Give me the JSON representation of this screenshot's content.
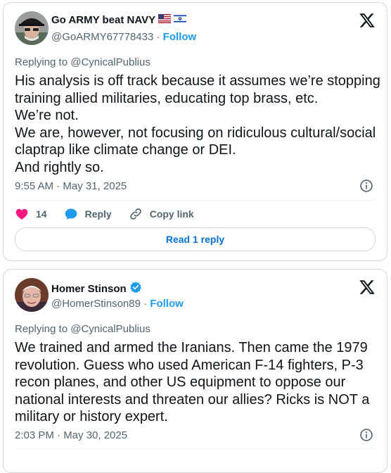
{
  "tweets": [
    {
      "display_name": "Go ARMY beat NAVY",
      "flags": [
        "us-flag-icon",
        "israel-flag-icon"
      ],
      "handle": "@GoARMY67778433",
      "separator": " · ",
      "follow_label": "Follow",
      "replying_to_prefix": "Replying to ",
      "replying_to_handle": "@CynicalPublius",
      "text_lines": [
        "His analysis is off track because it assumes we’re stopping",
        "training allied militaries, educating top brass, etc.",
        "We’re not.",
        "We are, however, not focusing on ridiculous cultural/social",
        "claptrap like climate change or DEI.",
        "And rightly so."
      ],
      "timestamp": "9:55 AM · May 31, 2025",
      "likes": "14",
      "reply_label": "Reply",
      "copy_link_label": "Copy link",
      "read_replies_label": "Read 1 reply"
    },
    {
      "display_name": "Homer Stinson",
      "verified": true,
      "handle": "@HomerStinson89",
      "separator": " · ",
      "follow_label": "Follow",
      "replying_to_prefix": "Replying to ",
      "replying_to_handle": "@CynicalPublius",
      "text_lines": [
        "We trained and armed the Iranians. Then came the 1979",
        "revolution. Guess who used American F-14 fighters, P-3",
        "recon planes, and other US equipment to oppose our",
        "national interests and threaten our allies? Ricks is NOT a",
        "military or history expert."
      ],
      "timestamp": "2:03 PM · May 30, 2025"
    }
  ],
  "colors": {
    "like_heart": "#f91880",
    "reply_bubble": "#1d9bf0",
    "link_blue": "#1d9bf0",
    "read_reply_text": "#006fd6",
    "secondary_text": "#536471",
    "border": "#cfd9de"
  }
}
